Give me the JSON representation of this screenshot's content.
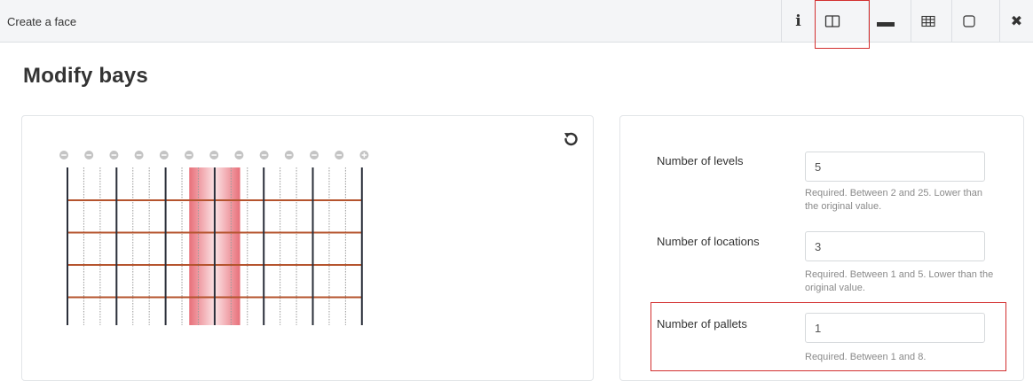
{
  "topbar": {
    "title": "Create a face",
    "buttons": [
      {
        "name": "info-button",
        "glyph": "i",
        "icon": "info-icon"
      },
      {
        "name": "split-view-button",
        "icon": "columns-icon"
      },
      {
        "name": "bay-button",
        "icon": "horizontal-bar-icon"
      },
      {
        "name": "grid-button",
        "icon": "table-grid-icon"
      },
      {
        "name": "frame-button",
        "icon": "rounded-square-icon"
      },
      {
        "name": "close-button",
        "glyph": "✖",
        "icon": "close-icon"
      }
    ]
  },
  "page": {
    "title": "Modify bays"
  },
  "diagram": {
    "bays": 12,
    "selected_bay": 5,
    "pallets_per_bay": 3,
    "beam_levels": 4,
    "reset_icon": "reset-rotate-icon",
    "add_icon": "plus-circle-icon",
    "colors": {
      "upright": "#2b2f3a",
      "beam": "#b5542e",
      "selection": "#e8707a",
      "handle": "#c4c4c4"
    }
  },
  "form": {
    "levels": {
      "label": "Number of levels",
      "value": "5",
      "help": "Required. Between 2 and 25. Lower than the original value."
    },
    "locations": {
      "label": "Number of locations",
      "value": "3",
      "help": "Required. Between 1 and 5. Lower than the original value."
    },
    "pallets": {
      "label": "Number of pallets",
      "value": "1",
      "help": "Required. Between 1 and 8."
    }
  },
  "colors": {
    "highlight": "#d32f2f",
    "border": "#e2e5e8",
    "topbar_bg": "#f4f5f7"
  }
}
